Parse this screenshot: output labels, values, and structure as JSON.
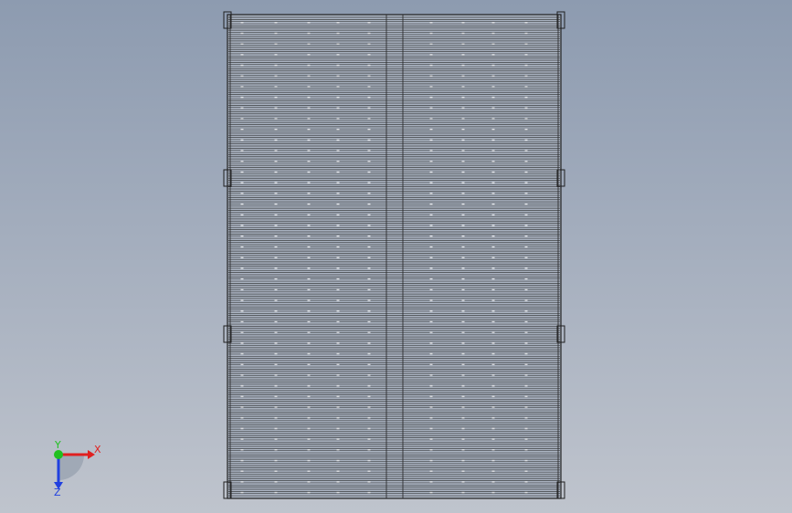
{
  "viewport": {
    "background_top": "#8d9bb0",
    "background_bottom": "#bfc4cd",
    "line_color": "#2a2a2a",
    "frame_color": "#1f1f1f",
    "panel_fill": "#a9b2c0"
  },
  "triad": {
    "x_label": "X",
    "y_label": "Y",
    "z_label": "Z",
    "x_color": "#e02020",
    "y_color": "#20c020",
    "z_color": "#2040e0"
  }
}
